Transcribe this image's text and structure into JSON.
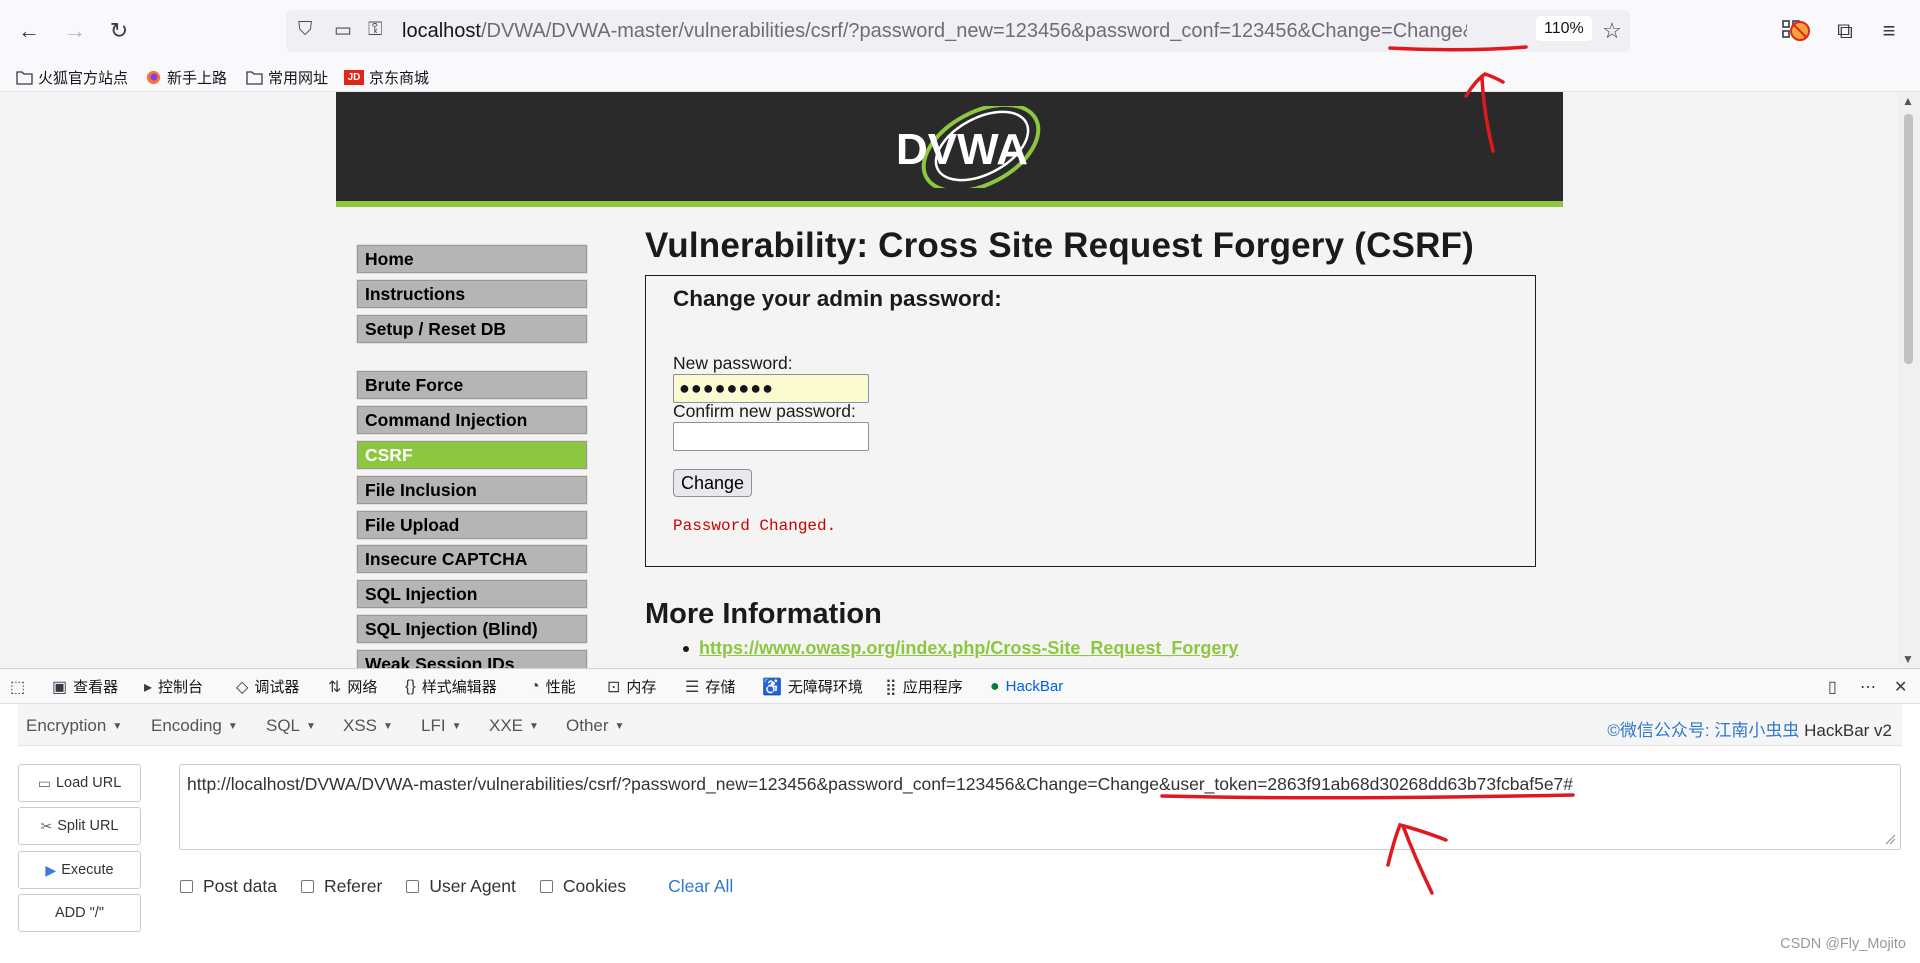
{
  "browser": {
    "url_host": "localhost",
    "url_path": "/DVWA/DVWA-master/vulnerabilities/csrf/?password_new=123456&password_conf=123456&Change=Change&user_toke",
    "zoom": "110%",
    "bookmarks": [
      "火狐官方站点",
      "新手上路",
      "常用网址",
      "京东商城"
    ]
  },
  "dvwa": {
    "logo_text": "DVWA",
    "menu_group1": [
      "Home",
      "Instructions",
      "Setup / Reset DB"
    ],
    "menu_group2": [
      "Brute Force",
      "Command Injection",
      "CSRF",
      "File Inclusion",
      "File Upload",
      "Insecure CAPTCHA",
      "SQL Injection",
      "SQL Injection (Blind)",
      "Weak Session IDs"
    ],
    "active_item": "CSRF",
    "title": "Vulnerability: Cross Site Request Forgery (CSRF)",
    "form": {
      "heading": "Change your admin password:",
      "new_label": "New password:",
      "new_value": "●●●●●●●●",
      "confirm_label": "Confirm new password:",
      "confirm_value": "",
      "button": "Change",
      "message": "Password Changed."
    },
    "more_info": "More Information",
    "link": "https://www.owasp.org/index.php/Cross-Site_Request_Forgery"
  },
  "devtools": {
    "tabs": [
      "查看器",
      "控制台",
      "调试器",
      "网络",
      "样式编辑器",
      "性能",
      "内存",
      "存储",
      "无障碍环境",
      "应用程序",
      "HackBar"
    ],
    "active_tab": "HackBar"
  },
  "hackbar": {
    "menus": [
      "Encryption",
      "Encoding",
      "SQL",
      "XSS",
      "LFI",
      "XXE",
      "Other"
    ],
    "brand_prefix": "©微信公众号:",
    "brand_name": "江南小虫虫",
    "brand_suffix": "HackBar v2",
    "buttons": [
      "Load URL",
      "Split URL",
      "Execute",
      "ADD \"/\""
    ],
    "url": "http://localhost/DVWA/DVWA-master/vulnerabilities/csrf/?password_new=123456&password_conf=123456&Change=Change&user_token=2863f91ab68d30268dd63b73fcbaf5e7#",
    "checks": [
      "Post data",
      "Referer",
      "User Agent",
      "Cookies"
    ],
    "clear": "Clear All",
    "watermark": "CSDN @Fly_Mojito"
  },
  "colors": {
    "dvwa_green": "#8dc63f",
    "annotation_red": "#e0191f",
    "link_blue": "#3079c9"
  }
}
